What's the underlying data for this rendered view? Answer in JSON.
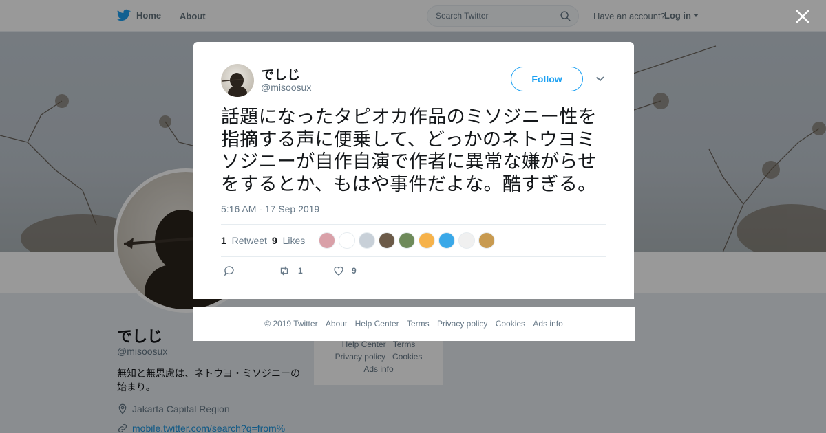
{
  "nav": {
    "home_label": "Home",
    "about_label": "About",
    "search_placeholder": "Search Twitter",
    "have_account": "Have an account?",
    "login_label": "Log in"
  },
  "profile": {
    "name": "でしじ",
    "handle": "@misoosux",
    "bio": "無知と無思慮は、ネトウヨ・ミソジニーの始まり。",
    "location": "Jakarta Capital Region",
    "link": "mobile.twitter.com/search?q=from%"
  },
  "side_footer": {
    "line1": [
      "Help Center",
      "Terms"
    ],
    "line2": [
      "Privacy policy",
      "Cookies"
    ],
    "line3": [
      "Ads info"
    ]
  },
  "tweet": {
    "author_name": "でしじ",
    "author_handle": "@misoosux",
    "follow_label": "Follow",
    "text": "話題になったタピオカ作品のミソジニー性を指摘する声に便乗して、どっかのネトウヨミソジニーが自作自演で作者に異常な嫌がらせをするとか、もはや事件だよな。酷すぎる。",
    "timestamp": "5:16 AM - 17 Sep 2019",
    "retweet_count": "1",
    "retweet_label": "Retweet",
    "like_count": "9",
    "like_label": "Likes",
    "action_retweet_count": "1",
    "action_like_count": "9"
  },
  "likers": [
    "#d9a0a8",
    "#ffffff",
    "#c8d0d8",
    "#6b5a48",
    "#6e8a5a",
    "#f6b24a",
    "#3aa8e8",
    "#f0f0f0",
    "#c89a50"
  ],
  "footer": {
    "copyright": "© 2019 Twitter",
    "about": "About",
    "help": "Help Center",
    "terms": "Terms",
    "privacy": "Privacy policy",
    "cookies": "Cookies",
    "ads": "Ads info"
  },
  "colors": {
    "accent": "#1da1f2",
    "muted": "#657786"
  }
}
